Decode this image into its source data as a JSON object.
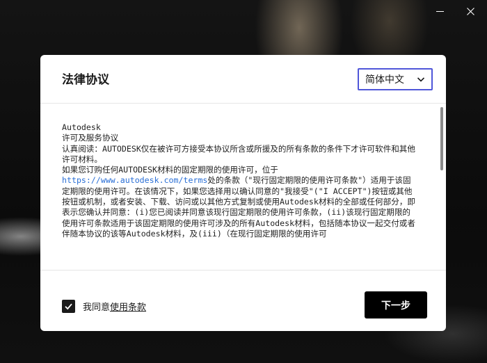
{
  "window": {
    "minimize_icon": "minimize-icon",
    "close_icon": "close-icon"
  },
  "dialog": {
    "title": "法律协议",
    "language": {
      "selected": "简体中文",
      "icon": "chevron-down-icon",
      "accent_color": "#4f56d9"
    },
    "legal_text": {
      "company": "Autodesk",
      "heading": "许可及服务协议",
      "notice": "认真阅读：AUTODESK仅在被许可方接受本协议所含或所援及的所有条款的条件下才许可软件和其他许可材料。",
      "body_before_link": "如果您订购任何AUTODESK材料的固定期限的使用许可，位于",
      "link": "https://www.autodesk.com/terms",
      "body_after_link": "处的条款（\"现行固定期限的使用许可条款\"）适用于该固定期限的使用许可。在该情况下，如果您选择用以确认同意的\"我接受\"(\"I ACCEPT\")按钮或其他按钮或机制，或者安装、下载、访问或以其他方式复制或使用Autodesk材料的全部或任何部分，即表示您确认并同意：(i)您已阅读并同意该现行固定期限的使用许可条款，(ii)该现行固定期限的使用许可条款适用于该固定期限的使用许可涉及的所有Autodesk材料，包括随本协议一起交付或者伴随本协议的该等Autodesk材料，及(iii)（在现行固定期限的使用许可"
    },
    "agree": {
      "checked": true,
      "label_prefix": "我同意",
      "link_text": "使用条款"
    },
    "next_button_label": "下一步"
  }
}
